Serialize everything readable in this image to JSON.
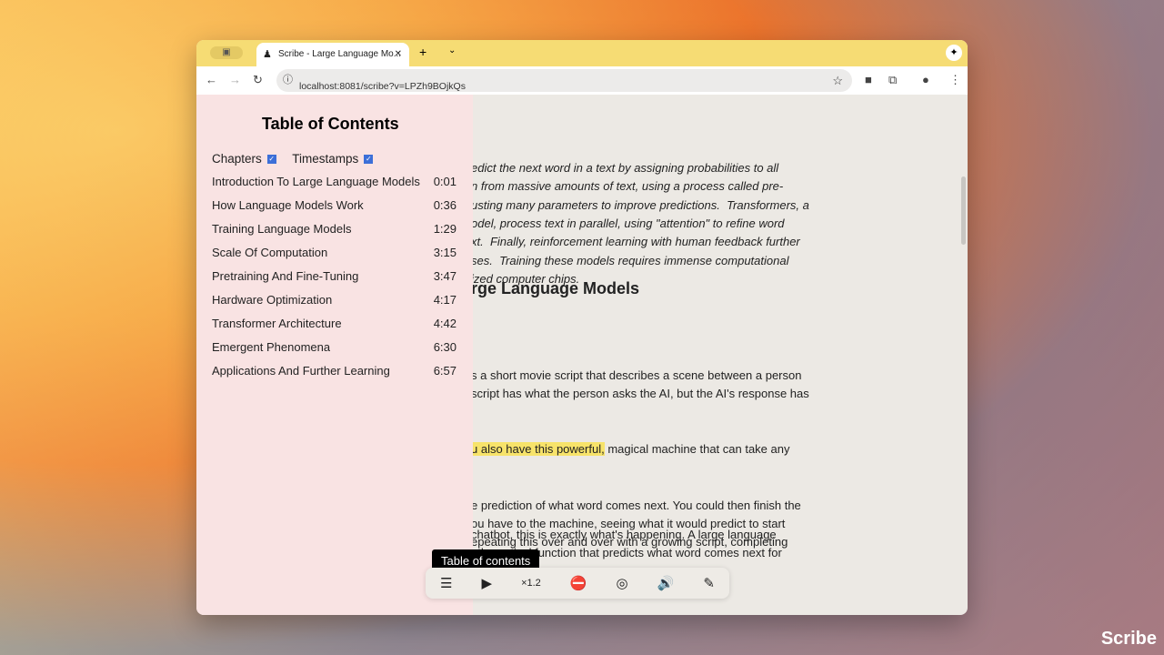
{
  "browser": {
    "tab_title": "Scribe - Large Language Mo...",
    "url": "localhost:8081/scribe?v=LPZh9BOjkQs"
  },
  "article": {
    "summary_lines": [
      "edict the next word in a text by assigning probabilities to all",
      "n from massive amounts of text, using a process called pre-",
      "usting many parameters to improve predictions.  Transformers, a",
      "odel, process text in parallel, using \"attention\" to refine word",
      "xt.  Finally, reinforcement learning with human feedback further",
      "ses.  Training these models requires immense computational",
      "ized computer chips."
    ],
    "heading": "rge Language Models",
    "para1": [
      "s a short movie script that describes a scene between a person",
      "script has what the person asks the AI, but the AI's response has"
    ],
    "para1_hl": "u also have this powerful,",
    "para1_hl_rest": " magical machine that can take any",
    "para1_more": [
      "e prediction of what word comes next. You could then finish the",
      "ou have to the machine, seeing what it would predict to start",
      "epeating this over and over with a growing script, completing"
    ],
    "para2": [
      "chatbot, this is exactly what's happening. A large language",
      "athematical function that predicts what word comes next for"
    ]
  },
  "toc": {
    "title": "Table of Contents",
    "chapters_label": "Chapters",
    "timestamps_label": "Timestamps",
    "items": [
      {
        "title": "Introduction To Large Language Models",
        "time": "0:01"
      },
      {
        "title": "How Language Models Work",
        "time": "0:36"
      },
      {
        "title": "Training Language Models",
        "time": "1:29"
      },
      {
        "title": "Scale Of Computation",
        "time": "3:15"
      },
      {
        "title": "Pretraining And Fine-Tuning",
        "time": "3:47"
      },
      {
        "title": "Hardware Optimization",
        "time": "4:17"
      },
      {
        "title": "Transformer Architecture",
        "time": "4:42"
      },
      {
        "title": "Emergent Phenomena",
        "time": "6:30"
      },
      {
        "title": "Applications And Further Learning",
        "time": "6:57"
      }
    ]
  },
  "controls": {
    "tooltip": "Table of contents",
    "speed": "×1.2"
  },
  "brand": "Scribe"
}
